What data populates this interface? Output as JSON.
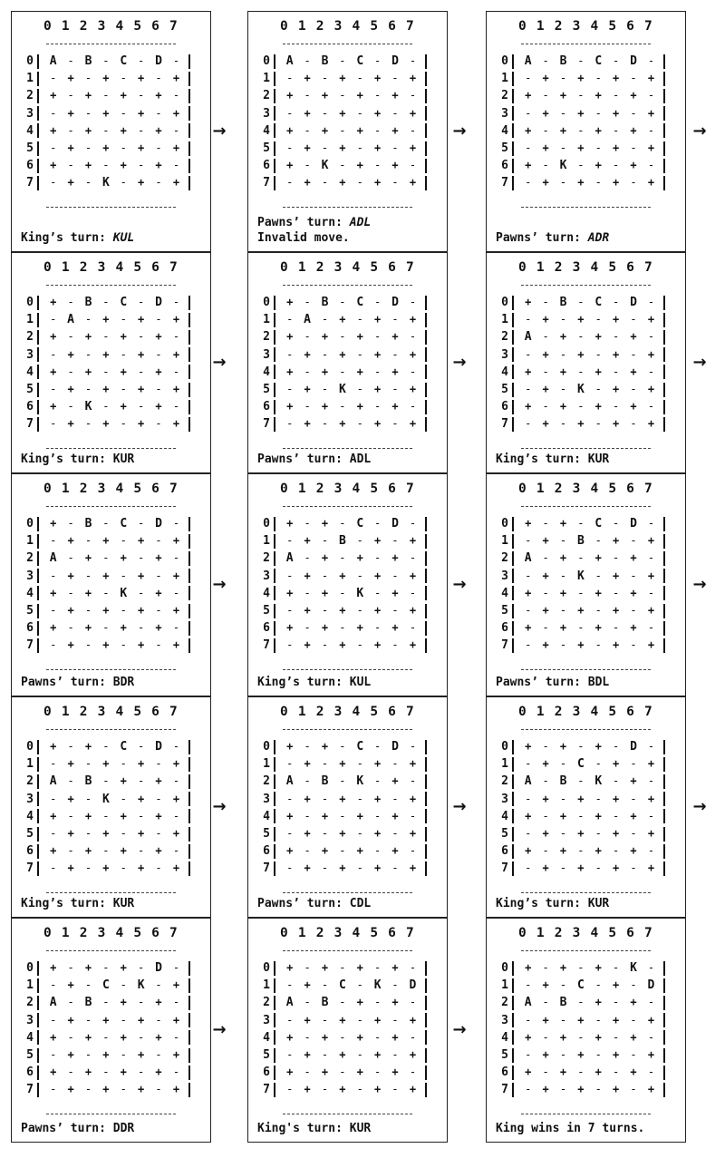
{
  "column_header": "0 1 2 3 4 5 6 7",
  "row_labels": [
    "0",
    "1",
    "2",
    "3",
    "4",
    "5",
    "6",
    "7"
  ],
  "arrow_glyph": "→",
  "panels": [
    {
      "board": [
        [
          "A",
          "-",
          "B",
          "-",
          "C",
          "-",
          "D",
          "-"
        ],
        [
          "-",
          "+",
          "-",
          "+",
          "-",
          "+",
          "-",
          "+"
        ],
        [
          "+",
          "-",
          "+",
          "-",
          "+",
          "-",
          "+",
          "-"
        ],
        [
          "-",
          "+",
          "-",
          "+",
          "-",
          "+",
          "-",
          "+"
        ],
        [
          "+",
          "-",
          "+",
          "-",
          "+",
          "-",
          "+",
          "-"
        ],
        [
          "-",
          "+",
          "-",
          "+",
          "-",
          "+",
          "-",
          "+"
        ],
        [
          "+",
          "-",
          "+",
          "-",
          "+",
          "-",
          "+",
          "-"
        ],
        [
          "-",
          "+",
          "-",
          "K",
          "-",
          "+",
          "-",
          "+"
        ]
      ],
      "caption_prefix": "King’s turn: ",
      "caption_move": "KUL",
      "move_italic": true,
      "caption_extra": ""
    },
    {
      "board": [
        [
          "A",
          "-",
          "B",
          "-",
          "C",
          "-",
          "D",
          "-"
        ],
        [
          "-",
          "+",
          "-",
          "+",
          "-",
          "+",
          "-",
          "+"
        ],
        [
          "+",
          "-",
          "+",
          "-",
          "+",
          "-",
          "+",
          "-"
        ],
        [
          "-",
          "+",
          "-",
          "+",
          "-",
          "+",
          "-",
          "+"
        ],
        [
          "+",
          "-",
          "+",
          "-",
          "+",
          "-",
          "+",
          "-"
        ],
        [
          "-",
          "+",
          "-",
          "+",
          "-",
          "+",
          "-",
          "+"
        ],
        [
          "+",
          "-",
          "K",
          "-",
          "+",
          "-",
          "+",
          "-"
        ],
        [
          "-",
          "+",
          "-",
          "+",
          "-",
          "+",
          "-",
          "+"
        ]
      ],
      "caption_prefix": "Pawns’ turn: ",
      "caption_move": "ADL",
      "move_italic": true,
      "caption_extra": "Invalid move."
    },
    {
      "board": [
        [
          "A",
          "-",
          "B",
          "-",
          "C",
          "-",
          "D",
          "-"
        ],
        [
          "-",
          "+",
          "-",
          "+",
          "-",
          "+",
          "-",
          "+"
        ],
        [
          "+",
          "-",
          "+",
          "-",
          "+",
          "-",
          "+",
          "-"
        ],
        [
          "-",
          "+",
          "-",
          "+",
          "-",
          "+",
          "-",
          "+"
        ],
        [
          "+",
          "-",
          "+",
          "-",
          "+",
          "-",
          "+",
          "-"
        ],
        [
          "-",
          "+",
          "-",
          "+",
          "-",
          "+",
          "-",
          "+"
        ],
        [
          "+",
          "-",
          "K",
          "-",
          "+",
          "-",
          "+",
          "-"
        ],
        [
          "-",
          "+",
          "-",
          "+",
          "-",
          "+",
          "-",
          "+"
        ]
      ],
      "caption_prefix": "Pawns’ turn: ",
      "caption_move": "ADR",
      "move_italic": true,
      "caption_extra": ""
    },
    {
      "board": [
        [
          "+",
          "-",
          "B",
          "-",
          "C",
          "-",
          "D",
          "-"
        ],
        [
          "-",
          "A",
          "-",
          "+",
          "-",
          "+",
          "-",
          "+"
        ],
        [
          "+",
          "-",
          "+",
          "-",
          "+",
          "-",
          "+",
          "-"
        ],
        [
          "-",
          "+",
          "-",
          "+",
          "-",
          "+",
          "-",
          "+"
        ],
        [
          "+",
          "-",
          "+",
          "-",
          "+",
          "-",
          "+",
          "-"
        ],
        [
          "-",
          "+",
          "-",
          "+",
          "-",
          "+",
          "-",
          "+"
        ],
        [
          "+",
          "-",
          "K",
          "-",
          "+",
          "-",
          "+",
          "-"
        ],
        [
          "-",
          "+",
          "-",
          "+",
          "-",
          "+",
          "-",
          "+"
        ]
      ],
      "caption_prefix": "King’s turn: ",
      "caption_move": "KUR",
      "move_italic": false,
      "caption_extra": ""
    },
    {
      "board": [
        [
          "+",
          "-",
          "B",
          "-",
          "C",
          "-",
          "D",
          "-"
        ],
        [
          "-",
          "A",
          "-",
          "+",
          "-",
          "+",
          "-",
          "+"
        ],
        [
          "+",
          "-",
          "+",
          "-",
          "+",
          "-",
          "+",
          "-"
        ],
        [
          "-",
          "+",
          "-",
          "+",
          "-",
          "+",
          "-",
          "+"
        ],
        [
          "+",
          "-",
          "+",
          "-",
          "+",
          "-",
          "+",
          "-"
        ],
        [
          "-",
          "+",
          "-",
          "K",
          "-",
          "+",
          "-",
          "+"
        ],
        [
          "+",
          "-",
          "+",
          "-",
          "+",
          "-",
          "+",
          "-"
        ],
        [
          "-",
          "+",
          "-",
          "+",
          "-",
          "+",
          "-",
          "+"
        ]
      ],
      "caption_prefix": "Pawns’ turn: ",
      "caption_move": "ADL",
      "move_italic": false,
      "caption_extra": ""
    },
    {
      "board": [
        [
          "+",
          "-",
          "B",
          "-",
          "C",
          "-",
          "D",
          "-"
        ],
        [
          "-",
          "+",
          "-",
          "+",
          "-",
          "+",
          "-",
          "+"
        ],
        [
          "A",
          "-",
          "+",
          "-",
          "+",
          "-",
          "+",
          "-"
        ],
        [
          "-",
          "+",
          "-",
          "+",
          "-",
          "+",
          "-",
          "+"
        ],
        [
          "+",
          "-",
          "+",
          "-",
          "+",
          "-",
          "+",
          "-"
        ],
        [
          "-",
          "+",
          "-",
          "K",
          "-",
          "+",
          "-",
          "+"
        ],
        [
          "+",
          "-",
          "+",
          "-",
          "+",
          "-",
          "+",
          "-"
        ],
        [
          "-",
          "+",
          "-",
          "+",
          "-",
          "+",
          "-",
          "+"
        ]
      ],
      "caption_prefix": "King’s turn: ",
      "caption_move": "KUR",
      "move_italic": false,
      "caption_extra": ""
    },
    {
      "board": [
        [
          "+",
          "-",
          "B",
          "-",
          "C",
          "-",
          "D",
          "-"
        ],
        [
          "-",
          "+",
          "-",
          "+",
          "-",
          "+",
          "-",
          "+"
        ],
        [
          "A",
          "-",
          "+",
          "-",
          "+",
          "-",
          "+",
          "-"
        ],
        [
          "-",
          "+",
          "-",
          "+",
          "-",
          "+",
          "-",
          "+"
        ],
        [
          "+",
          "-",
          "+",
          "-",
          "K",
          "-",
          "+",
          "-"
        ],
        [
          "-",
          "+",
          "-",
          "+",
          "-",
          "+",
          "-",
          "+"
        ],
        [
          "+",
          "-",
          "+",
          "-",
          "+",
          "-",
          "+",
          "-"
        ],
        [
          "-",
          "+",
          "-",
          "+",
          "-",
          "+",
          "-",
          "+"
        ]
      ],
      "caption_prefix": "Pawns’ turn: ",
      "caption_move": "BDR",
      "move_italic": false,
      "caption_extra": ""
    },
    {
      "board": [
        [
          "+",
          "-",
          "+",
          "-",
          "C",
          "-",
          "D",
          "-"
        ],
        [
          "-",
          "+",
          "-",
          "B",
          "-",
          "+",
          "-",
          "+"
        ],
        [
          "A",
          "-",
          "+",
          "-",
          "+",
          "-",
          "+",
          "-"
        ],
        [
          "-",
          "+",
          "-",
          "+",
          "-",
          "+",
          "-",
          "+"
        ],
        [
          "+",
          "-",
          "+",
          "-",
          "K",
          "-",
          "+",
          "-"
        ],
        [
          "-",
          "+",
          "-",
          "+",
          "-",
          "+",
          "-",
          "+"
        ],
        [
          "+",
          "-",
          "+",
          "-",
          "+",
          "-",
          "+",
          "-"
        ],
        [
          "-",
          "+",
          "-",
          "+",
          "-",
          "+",
          "-",
          "+"
        ]
      ],
      "caption_prefix": "King’s turn: ",
      "caption_move": "KUL",
      "move_italic": false,
      "caption_extra": ""
    },
    {
      "board": [
        [
          "+",
          "-",
          "+",
          "-",
          "C",
          "-",
          "D",
          "-"
        ],
        [
          "-",
          "+",
          "-",
          "B",
          "-",
          "+",
          "-",
          "+"
        ],
        [
          "A",
          "-",
          "+",
          "-",
          "+",
          "-",
          "+",
          "-"
        ],
        [
          "-",
          "+",
          "-",
          "K",
          "-",
          "+",
          "-",
          "+"
        ],
        [
          "+",
          "-",
          "+",
          "-",
          "+",
          "-",
          "+",
          "-"
        ],
        [
          "-",
          "+",
          "-",
          "+",
          "-",
          "+",
          "-",
          "+"
        ],
        [
          "+",
          "-",
          "+",
          "-",
          "+",
          "-",
          "+",
          "-"
        ],
        [
          "-",
          "+",
          "-",
          "+",
          "-",
          "+",
          "-",
          "+"
        ]
      ],
      "caption_prefix": "Pawns’ turn: ",
      "caption_move": "BDL",
      "move_italic": false,
      "caption_extra": ""
    },
    {
      "board": [
        [
          "+",
          "-",
          "+",
          "-",
          "C",
          "-",
          "D",
          "-"
        ],
        [
          "-",
          "+",
          "-",
          "+",
          "-",
          "+",
          "-",
          "+"
        ],
        [
          "A",
          "-",
          "B",
          "-",
          "+",
          "-",
          "+",
          "-"
        ],
        [
          "-",
          "+",
          "-",
          "K",
          "-",
          "+",
          "-",
          "+"
        ],
        [
          "+",
          "-",
          "+",
          "-",
          "+",
          "-",
          "+",
          "-"
        ],
        [
          "-",
          "+",
          "-",
          "+",
          "-",
          "+",
          "-",
          "+"
        ],
        [
          "+",
          "-",
          "+",
          "-",
          "+",
          "-",
          "+",
          "-"
        ],
        [
          "-",
          "+",
          "-",
          "+",
          "-",
          "+",
          "-",
          "+"
        ]
      ],
      "caption_prefix": "King’s turn: ",
      "caption_move": "KUR",
      "move_italic": false,
      "caption_extra": ""
    },
    {
      "board": [
        [
          "+",
          "-",
          "+",
          "-",
          "C",
          "-",
          "D",
          "-"
        ],
        [
          "-",
          "+",
          "-",
          "+",
          "-",
          "+",
          "-",
          "+"
        ],
        [
          "A",
          "-",
          "B",
          "-",
          "K",
          "-",
          "+",
          "-"
        ],
        [
          "-",
          "+",
          "-",
          "+",
          "-",
          "+",
          "-",
          "+"
        ],
        [
          "+",
          "-",
          "+",
          "-",
          "+",
          "-",
          "+",
          "-"
        ],
        [
          "-",
          "+",
          "-",
          "+",
          "-",
          "+",
          "-",
          "+"
        ],
        [
          "+",
          "-",
          "+",
          "-",
          "+",
          "-",
          "+",
          "-"
        ],
        [
          "-",
          "+",
          "-",
          "+",
          "-",
          "+",
          "-",
          "+"
        ]
      ],
      "caption_prefix": "Pawns’ turn: ",
      "caption_move": "CDL",
      "move_italic": false,
      "caption_extra": ""
    },
    {
      "board": [
        [
          "+",
          "-",
          "+",
          "-",
          "+",
          "-",
          "D",
          "-"
        ],
        [
          "-",
          "+",
          "-",
          "C",
          "-",
          "+",
          "-",
          "+"
        ],
        [
          "A",
          "-",
          "B",
          "-",
          "K",
          "-",
          "+",
          "-"
        ],
        [
          "-",
          "+",
          "-",
          "+",
          "-",
          "+",
          "-",
          "+"
        ],
        [
          "+",
          "-",
          "+",
          "-",
          "+",
          "-",
          "+",
          "-"
        ],
        [
          "-",
          "+",
          "-",
          "+",
          "-",
          "+",
          "-",
          "+"
        ],
        [
          "+",
          "-",
          "+",
          "-",
          "+",
          "-",
          "+",
          "-"
        ],
        [
          "-",
          "+",
          "-",
          "+",
          "-",
          "+",
          "-",
          "+"
        ]
      ],
      "caption_prefix": "King’s turn: ",
      "caption_move": "KUR",
      "move_italic": false,
      "caption_extra": ""
    },
    {
      "board": [
        [
          "+",
          "-",
          "+",
          "-",
          "+",
          "-",
          "D",
          "-"
        ],
        [
          "-",
          "+",
          "-",
          "C",
          "-",
          "K",
          "-",
          "+"
        ],
        [
          "A",
          "-",
          "B",
          "-",
          "+",
          "-",
          "+",
          "-"
        ],
        [
          "-",
          "+",
          "-",
          "+",
          "-",
          "+",
          "-",
          "+"
        ],
        [
          "+",
          "-",
          "+",
          "-",
          "+",
          "-",
          "+",
          "-"
        ],
        [
          "-",
          "+",
          "-",
          "+",
          "-",
          "+",
          "-",
          "+"
        ],
        [
          "+",
          "-",
          "+",
          "-",
          "+",
          "-",
          "+",
          "-"
        ],
        [
          "-",
          "+",
          "-",
          "+",
          "-",
          "+",
          "-",
          "+"
        ]
      ],
      "caption_prefix": "Pawns’ turn: ",
      "caption_move": "DDR",
      "move_italic": false,
      "caption_extra": ""
    },
    {
      "board": [
        [
          "+",
          "-",
          "+",
          "-",
          "+",
          "-",
          "+",
          "-"
        ],
        [
          "-",
          "+",
          "-",
          "C",
          "-",
          "K",
          "-",
          "D"
        ],
        [
          "A",
          "-",
          "B",
          "-",
          "+",
          "-",
          "+",
          "-"
        ],
        [
          "-",
          "+",
          "-",
          "+",
          "-",
          "+",
          "-",
          "+"
        ],
        [
          "+",
          "-",
          "+",
          "-",
          "+",
          "-",
          "+",
          "-"
        ],
        [
          "-",
          "+",
          "-",
          "+",
          "-",
          "+",
          "-",
          "+"
        ],
        [
          "+",
          "-",
          "+",
          "-",
          "+",
          "-",
          "+",
          "-"
        ],
        [
          "-",
          "+",
          "-",
          "+",
          "-",
          "+",
          "-",
          "+"
        ]
      ],
      "caption_prefix": "King's turn: ",
      "caption_move": "KUR",
      "move_italic": false,
      "caption_extra": ""
    },
    {
      "board": [
        [
          "+",
          "-",
          "+",
          "-",
          "+",
          "-",
          "K",
          "-"
        ],
        [
          "-",
          "+",
          "-",
          "C",
          "-",
          "+",
          "-",
          "D"
        ],
        [
          "A",
          "-",
          "B",
          "-",
          "+",
          "-",
          "+",
          "-"
        ],
        [
          "-",
          "+",
          "-",
          "+",
          "-",
          "+",
          "-",
          "+"
        ],
        [
          "+",
          "-",
          "+",
          "-",
          "+",
          "-",
          "+",
          "-"
        ],
        [
          "-",
          "+",
          "-",
          "+",
          "-",
          "+",
          "-",
          "+"
        ],
        [
          "+",
          "-",
          "+",
          "-",
          "+",
          "-",
          "+",
          "-"
        ],
        [
          "-",
          "+",
          "-",
          "+",
          "-",
          "+",
          "-",
          "+"
        ]
      ],
      "caption_prefix": "King wins in 7 turns.",
      "caption_move": "",
      "move_italic": false,
      "caption_extra": ""
    }
  ]
}
